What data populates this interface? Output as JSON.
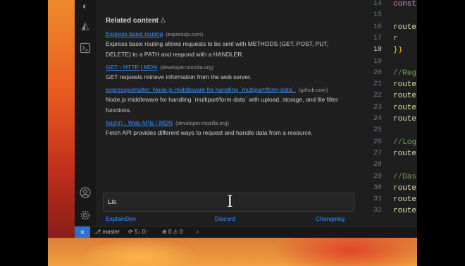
{
  "panel": {
    "title": "Related content",
    "title_symbol": "Δ",
    "items": [
      {
        "link": "Express basic routing",
        "domain": "(expressjs.com)",
        "desc": "Express basic routing allows requests to be sent with METHODS (GET, POST, PUT, DELETE) to a PATH and respond with a HANDLER."
      },
      {
        "link": "GET - HTTP | MDN",
        "domain": "(developer.mozilla.org)",
        "desc": "GET requests retrieve information from the web server."
      },
      {
        "link": "expressjs/multer: Node.js middleware for handling `multipart/form-data`.",
        "domain": "(github.com)",
        "desc": "Node.js middleware for handling `multipart/form-data` with upload, storage, and file filter functions."
      },
      {
        "link": "fetch() - Web APIs | MDN",
        "domain": "(developer.mozilla.org)",
        "desc": "Fetch API provides different ways to request and handle data from a resource."
      }
    ],
    "input_value": "Lis",
    "footer": {
      "explain": "ExplainDev",
      "discord": "Discord",
      "changelog": "Changelog"
    }
  },
  "editor": {
    "lines": [
      {
        "num": "14",
        "code": "const",
        "color": "#c586c0"
      },
      {
        "num": "15",
        "code": "",
        "color": "#dcdcaa"
      },
      {
        "num": "16",
        "code": "route",
        "color": "#dcdcaa"
      },
      {
        "num": "17",
        "code": "  r",
        "color": "#d7ba7d"
      },
      {
        "num": "18",
        "code": "})",
        "color": "#ffd700"
      },
      {
        "num": "19",
        "code": "",
        "color": "#cfcfcf"
      },
      {
        "num": "20",
        "code": "//Reg",
        "color": "#6a9955"
      },
      {
        "num": "21",
        "code": "route",
        "color": "#dcdcaa"
      },
      {
        "num": "22",
        "code": "route",
        "color": "#dcdcaa"
      },
      {
        "num": "23",
        "code": "route",
        "color": "#dcdcaa"
      },
      {
        "num": "24",
        "code": "route",
        "color": "#dcdcaa"
      },
      {
        "num": "25",
        "code": "",
        "color": "#cfcfcf"
      },
      {
        "num": "26",
        "code": "//Log",
        "color": "#6a9955"
      },
      {
        "num": "27",
        "code": "route",
        "color": "#dcdcaa"
      },
      {
        "num": "28",
        "code": "",
        "color": "#cfcfcf"
      },
      {
        "num": "29",
        "code": "//Das",
        "color": "#6a9955"
      },
      {
        "num": "30",
        "code": "route",
        "color": "#dcdcaa"
      },
      {
        "num": "31",
        "code": "route",
        "color": "#dcdcaa"
      },
      {
        "num": "32",
        "code": "route",
        "color": "#dcdcaa"
      }
    ],
    "active_line": "18"
  },
  "status": {
    "branch": "master",
    "sync": "5↓ 0↑",
    "problems": "0",
    "warnings": "0"
  },
  "colors": {
    "accent": "#2f6fd0",
    "link": "#3794ff"
  }
}
